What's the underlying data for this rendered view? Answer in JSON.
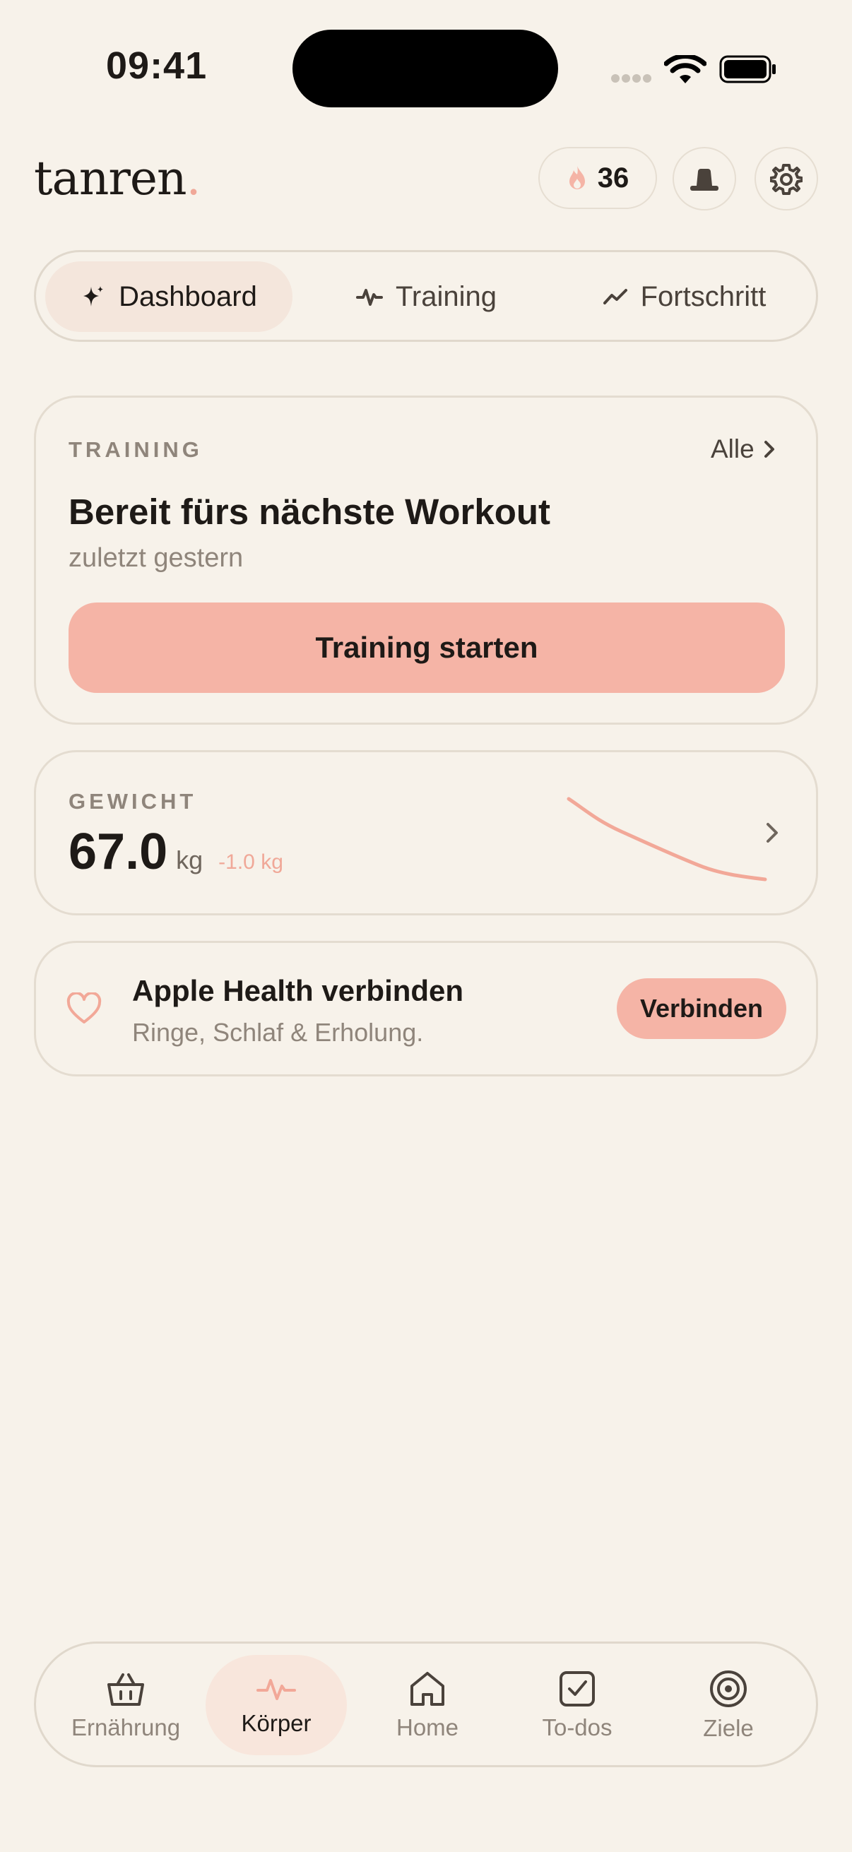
{
  "status_bar": {
    "time": "09:41"
  },
  "header": {
    "logo_text": "tanren",
    "logo_dot": ".",
    "streak_count": "36"
  },
  "tabs": [
    {
      "label": "Dashboard",
      "icon": "sparkle-icon",
      "active": true
    },
    {
      "label": "Training",
      "icon": "pulse-icon",
      "active": false
    },
    {
      "label": "Fortschritt",
      "icon": "trend-up-icon",
      "active": false
    }
  ],
  "training_card": {
    "label": "TRAINING",
    "all_link": "Alle",
    "title": "Bereit fürs nächste Workout",
    "subtitle": "zuletzt gestern",
    "cta_label": "Training starten"
  },
  "weight_card": {
    "label": "GEWICHT",
    "value": "67.0",
    "unit": "kg",
    "delta": "-1.0 kg"
  },
  "health_card": {
    "title": "Apple Health verbinden",
    "subtitle": "Ringe, Schlaf & Erholung.",
    "button_label": "Verbinden"
  },
  "bottom_nav": [
    {
      "label": "Ernährung",
      "icon": "basket-icon",
      "active": false
    },
    {
      "label": "Körper",
      "icon": "pulse-icon",
      "active": true
    },
    {
      "label": "Home",
      "icon": "home-icon",
      "active": false
    },
    {
      "label": "To-dos",
      "icon": "checkbox-icon",
      "active": false
    },
    {
      "label": "Ziele",
      "icon": "target-icon",
      "active": false
    }
  ],
  "colors": {
    "background": "#F7F2EA",
    "accent": "#F5B4A6",
    "accent_text": "#F0A898",
    "text": "#1E1A17",
    "muted": "#8F857B"
  }
}
